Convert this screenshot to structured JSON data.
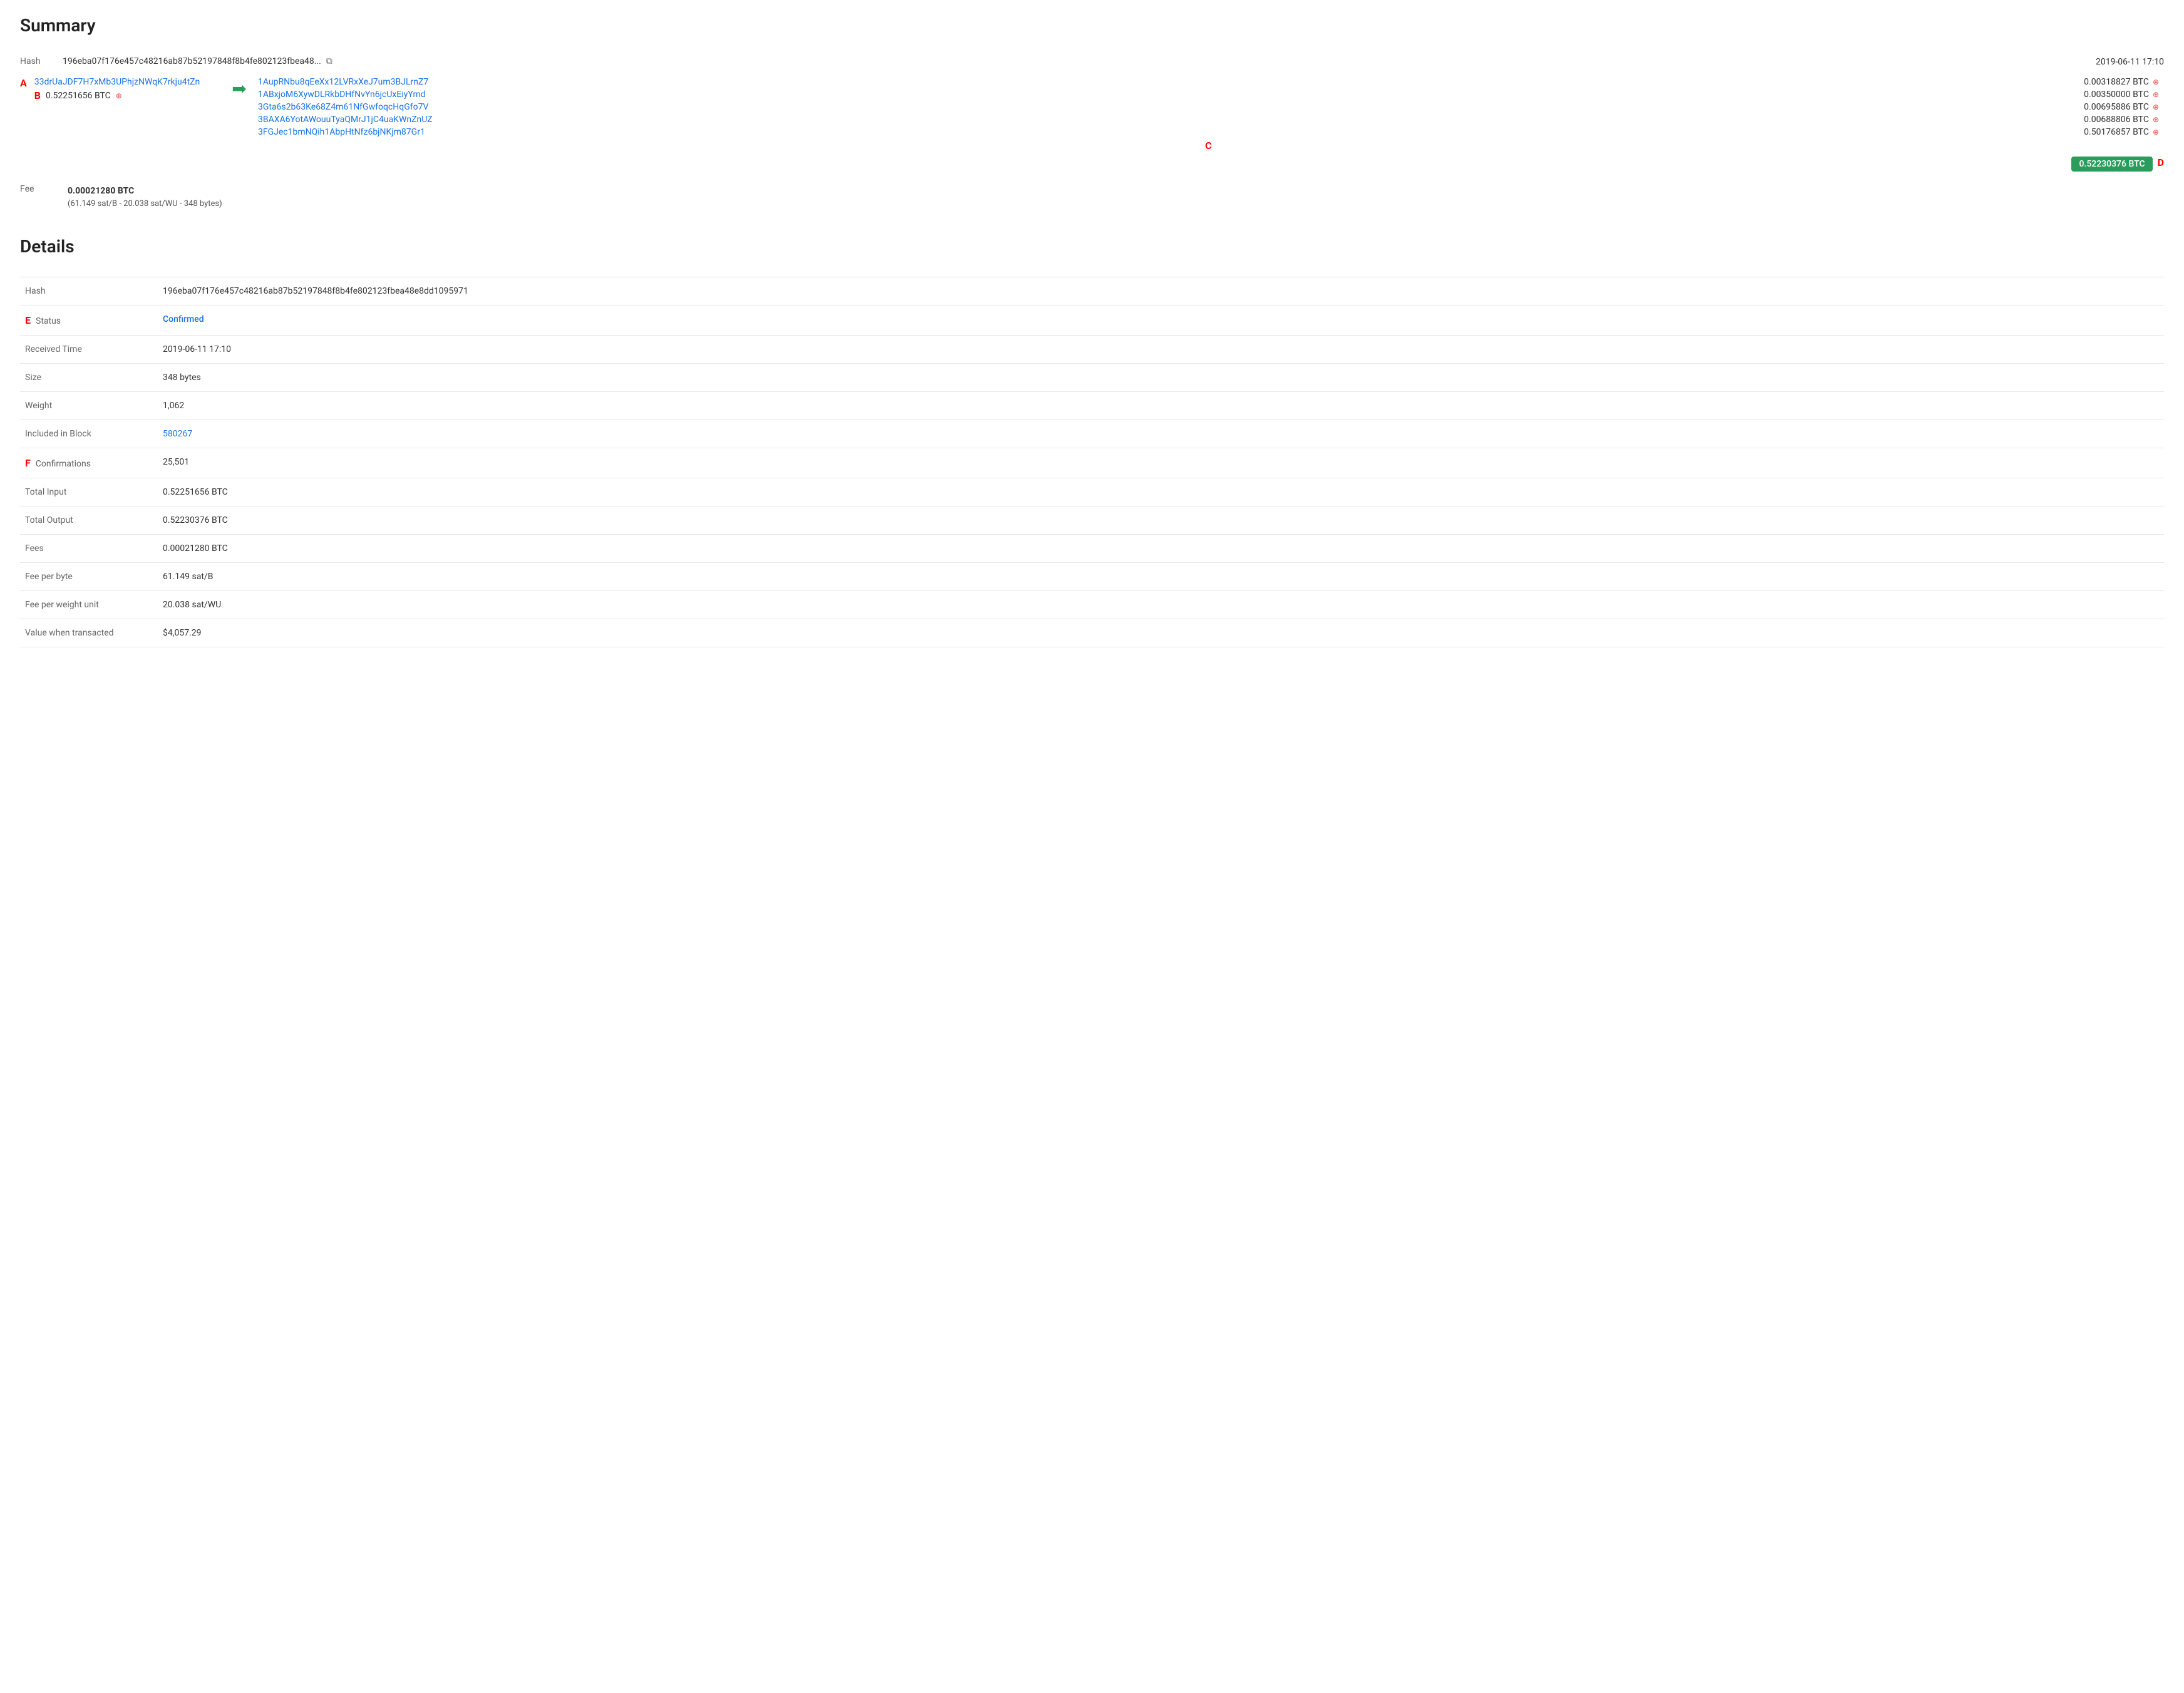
{
  "summary": {
    "title": "Summary",
    "hash_short": "196eba07f176e457c48216ab87b52197848f8b4fe802123fbea48...",
    "hash_full": "196eba07f176e457c48216ab87b52197848f8b4fe802123fbea48e8dd1095971",
    "timestamp": "2019-06-11 17:10",
    "annotation_a": "A",
    "annotation_b": "B",
    "annotation_c": "C",
    "annotation_d": "D",
    "input": {
      "address": "33drUaJDF7H7xMb3UPhjzNWqK7rkju4tZn",
      "amount": "0.52251656 BTC"
    },
    "outputs": [
      {
        "address": "1AupRNbu8qEeXx12LVRxXeJ7um3BJLrnZ7",
        "amount": "0.00318827 BTC"
      },
      {
        "address": "1ABxjoM6XywDLRkbDHfNvYn6jcUxEiyYmd",
        "amount": "0.00350000 BTC"
      },
      {
        "address": "3Gta6s2b63Ke68Z4m61NfGwfoqcHqGfo7V",
        "amount": "0.00695886 BTC"
      },
      {
        "address": "3BAXA6YotAWouuTyaQMrJ1jC4uaKWnZnUZ",
        "amount": "0.00688806 BTC"
      },
      {
        "address": "3FGJec1bmNQih1AbpHtNfz6bjNKjm87Gr1",
        "amount": "0.50176857 BTC"
      }
    ],
    "total_output": "0.52230376 BTC",
    "fee_label": "Fee",
    "fee_btc": "0.00021280 BTC",
    "fee_details": "(61.149 sat/B - 20.038 sat/WU - 348 bytes)"
  },
  "details": {
    "title": "Details",
    "annotation_e": "E",
    "annotation_f": "F",
    "rows": [
      {
        "label": "Hash",
        "value": "196eba07f176e457c48216ab87b52197848f8b4fe802123fbea48e8dd1095971",
        "type": "text"
      },
      {
        "label": "Status",
        "value": "Confirmed",
        "type": "confirmed"
      },
      {
        "label": "Received Time",
        "value": "2019-06-11 17:10",
        "type": "text"
      },
      {
        "label": "Size",
        "value": "348 bytes",
        "type": "text"
      },
      {
        "label": "Weight",
        "value": "1,062",
        "type": "text"
      },
      {
        "label": "Included in Block",
        "value": "580267",
        "type": "link"
      },
      {
        "label": "Confirmations",
        "value": "25,501",
        "type": "text"
      },
      {
        "label": "Total Input",
        "value": "0.52251656 BTC",
        "type": "text"
      },
      {
        "label": "Total Output",
        "value": "0.52230376 BTC",
        "type": "text"
      },
      {
        "label": "Fees",
        "value": "0.00021280 BTC",
        "type": "text"
      },
      {
        "label": "Fee per byte",
        "value": "61.149 sat/B",
        "type": "text"
      },
      {
        "label": "Fee per weight unit",
        "value": "20.038 sat/WU",
        "type": "text"
      },
      {
        "label": "Value when transacted",
        "value": "$4,057.29",
        "type": "text"
      }
    ]
  },
  "icons": {
    "copy": "⧉",
    "globe": "⊕",
    "arrow": "➡"
  }
}
